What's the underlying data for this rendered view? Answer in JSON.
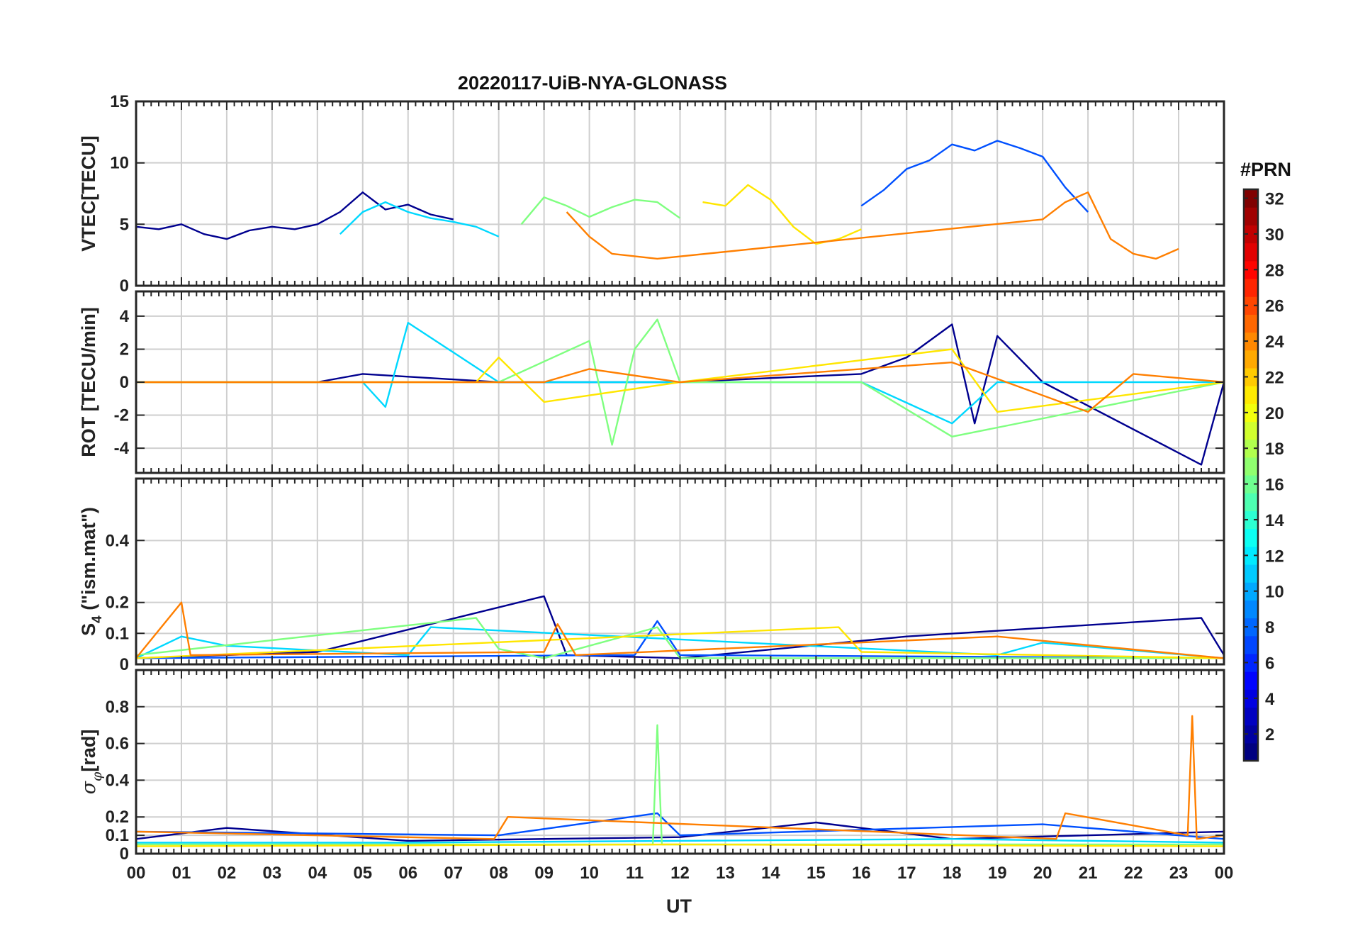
{
  "chart_data": {
    "type": "line",
    "title": "20220117-UiB-NYA-GLONASS",
    "xlabel": "UT",
    "xlim": [
      0,
      24
    ],
    "x_tick_labels": [
      "00",
      "01",
      "02",
      "03",
      "04",
      "05",
      "06",
      "07",
      "08",
      "09",
      "10",
      "11",
      "12",
      "13",
      "14",
      "15",
      "16",
      "17",
      "18",
      "19",
      "20",
      "21",
      "22",
      "23",
      "00"
    ],
    "colorbar": {
      "label": "#PRN",
      "range": [
        1,
        32
      ],
      "tick_labels": [
        "2",
        "4",
        "6",
        "8",
        "10",
        "12",
        "14",
        "16",
        "18",
        "20",
        "22",
        "24",
        "26",
        "28",
        "30",
        "32"
      ],
      "colormap": "jet"
    },
    "panels": [
      {
        "id": "vtec",
        "ylabel": "VTEC[TECU]",
        "ylim": [
          0,
          15
        ],
        "y_tick_labels": [
          "0",
          "5",
          "10",
          "15"
        ],
        "series": [
          {
            "color": "#00008f",
            "x": [
              0,
              0.5,
              1,
              1.5,
              2,
              2.5,
              3,
              3.5,
              4,
              4.5,
              5,
              5.5,
              6,
              6.5,
              7
            ],
            "y": [
              4.8,
              4.6,
              5.0,
              4.2,
              3.8,
              4.5,
              4.8,
              4.6,
              5.0,
              6.0,
              7.6,
              6.2,
              6.6,
              5.8,
              5.4
            ]
          },
          {
            "color": "#0050ff",
            "x": [
              16,
              16.5,
              17,
              17.5,
              18,
              18.5,
              19,
              19.5,
              20,
              20.5,
              21
            ],
            "y": [
              6.5,
              7.8,
              9.5,
              10.2,
              11.5,
              11.0,
              11.8,
              11.2,
              10.5,
              8.0,
              6.0
            ]
          },
          {
            "color": "#00d8ff",
            "x": [
              4.5,
              5,
              5.5,
              6,
              6.5,
              7,
              7.5,
              8
            ],
            "y": [
              4.2,
              6.0,
              6.8,
              6.0,
              5.5,
              5.2,
              4.8,
              4.0
            ]
          },
          {
            "color": "#7fff80",
            "x": [
              8.5,
              9,
              9.5,
              10,
              10.5,
              11,
              11.5,
              12
            ],
            "y": [
              5.0,
              7.2,
              6.5,
              5.6,
              6.4,
              7.0,
              6.8,
              5.5
            ]
          },
          {
            "color": "#ffe600",
            "x": [
              12.5,
              13,
              13.5,
              14,
              14.5,
              15,
              15.5,
              16
            ],
            "y": [
              6.8,
              6.5,
              8.2,
              7.0,
              4.8,
              3.4,
              3.8,
              4.6
            ]
          },
          {
            "color": "#ff7f00",
            "x": [
              9.5,
              10,
              10.5,
              11,
              11.5,
              20,
              20.5,
              21,
              21.5,
              22,
              22.5,
              23
            ],
            "y": [
              6.0,
              4.0,
              2.6,
              2.4,
              2.2,
              5.4,
              6.8,
              7.6,
              3.8,
              2.6,
              2.2,
              3.0
            ]
          }
        ]
      },
      {
        "id": "rot",
        "ylabel": "ROT [TECU/min]",
        "ylim": [
          -5.5,
          5.5
        ],
        "y_tick_labels": [
          "-4",
          "-2",
          "0",
          "2",
          "4"
        ],
        "y_ticks": [
          -4,
          -2,
          0,
          2,
          4
        ],
        "series": [
          {
            "color": "#00008f",
            "x": [
              0,
              4,
              5,
              8,
              12,
              16,
              17,
              18,
              18.5,
              19,
              20,
              23.5,
              24
            ],
            "y": [
              0,
              0,
              0.5,
              0,
              0,
              0.5,
              1.5,
              3.5,
              -2.5,
              2.8,
              0,
              -5,
              0
            ]
          },
          {
            "color": "#00d8ff",
            "x": [
              0,
              5,
              5.5,
              6,
              8,
              12,
              16,
              18,
              19,
              24
            ],
            "y": [
              0,
              0,
              -1.5,
              3.6,
              0,
              0,
              0,
              -2.5,
              0,
              0
            ]
          },
          {
            "color": "#7fff80",
            "x": [
              0,
              8,
              10,
              10.5,
              11,
              11.5,
              12,
              16,
              18,
              24
            ],
            "y": [
              0,
              0,
              2.5,
              -3.8,
              2.0,
              3.8,
              0,
              0,
              -3.3,
              0
            ]
          },
          {
            "color": "#ffe600",
            "x": [
              0,
              7.5,
              8,
              9,
              12,
              18,
              19,
              24
            ],
            "y": [
              0,
              0,
              1.5,
              -1.2,
              0,
              2.0,
              -1.8,
              0
            ]
          },
          {
            "color": "#ff7f00",
            "x": [
              0,
              9,
              10,
              12,
              18,
              21,
              22,
              24
            ],
            "y": [
              0,
              0,
              0.8,
              0,
              1.2,
              -1.8,
              0.5,
              0
            ]
          }
        ]
      },
      {
        "id": "s4",
        "ylabel": "S4 (\"ism.mat\")",
        "ylim": [
          0,
          0.6
        ],
        "y_tick_labels": [
          "0",
          "0.1",
          "0.2",
          "0.4"
        ],
        "y_ticks": [
          0,
          0.1,
          0.2,
          0.4
        ],
        "series": [
          {
            "color": "#00008f",
            "x": [
              0,
              4,
              9,
              9.5,
              12,
              17,
              23.5,
              24
            ],
            "y": [
              0.02,
              0.04,
              0.22,
              0.03,
              0.02,
              0.09,
              0.15,
              0.03
            ]
          },
          {
            "color": "#0050ff",
            "x": [
              0,
              11,
              11.5,
              12,
              24
            ],
            "y": [
              0.02,
              0.03,
              0.14,
              0.03,
              0.02
            ]
          },
          {
            "color": "#00d8ff",
            "x": [
              0,
              1,
              2,
              6,
              6.5,
              19,
              20,
              24
            ],
            "y": [
              0.02,
              0.09,
              0.06,
              0.03,
              0.12,
              0.03,
              0.07,
              0.02
            ]
          },
          {
            "color": "#7fff80",
            "x": [
              0,
              7.5,
              8,
              9,
              11.5,
              12,
              24
            ],
            "y": [
              0.03,
              0.15,
              0.05,
              0.02,
              0.12,
              0.02,
              0.02
            ]
          },
          {
            "color": "#ffe600",
            "x": [
              0,
              15.5,
              16,
              24
            ],
            "y": [
              0.02,
              0.12,
              0.04,
              0.02
            ]
          },
          {
            "color": "#ff7f00",
            "x": [
              0,
              1,
              1.2,
              9,
              9.3,
              9.7,
              19,
              24
            ],
            "y": [
              0.02,
              0.2,
              0.03,
              0.04,
              0.13,
              0.03,
              0.09,
              0.02
            ]
          }
        ]
      },
      {
        "id": "sigma_phi",
        "ylabel": "σ_φ[rad]",
        "ylim": [
          0,
          1.0
        ],
        "y_tick_labels": [
          "0",
          "0.1",
          "0.2",
          "0.4",
          "0.6",
          "0.8"
        ],
        "y_ticks": [
          0,
          0.1,
          0.2,
          0.4,
          0.6,
          0.8
        ],
        "series": [
          {
            "color": "#00008f",
            "x": [
              0,
              2,
              6,
              12,
              15,
              18,
              24
            ],
            "y": [
              0.08,
              0.14,
              0.07,
              0.09,
              0.17,
              0.08,
              0.12
            ]
          },
          {
            "color": "#0050ff",
            "x": [
              0,
              8,
              11.5,
              12,
              20,
              24
            ],
            "y": [
              0.12,
              0.1,
              0.22,
              0.1,
              0.16,
              0.08
            ]
          },
          {
            "color": "#00d8ff",
            "x": [
              0,
              6,
              12,
              18,
              24
            ],
            "y": [
              0.06,
              0.06,
              0.07,
              0.08,
              0.06
            ]
          },
          {
            "color": "#7fff80",
            "x": [
              0,
              11.4,
              11.5,
              11.6,
              24
            ],
            "y": [
              0.05,
              0.05,
              0.7,
              0.05,
              0.05
            ]
          },
          {
            "color": "#ffe600",
            "x": [
              0,
              12,
              24
            ],
            "y": [
              0.04,
              0.05,
              0.04
            ]
          },
          {
            "color": "#ff7f00",
            "x": [
              0,
              7.9,
              8.2,
              20.3,
              20.5,
              23.2,
              23.3,
              23.4,
              24
            ],
            "y": [
              0.12,
              0.08,
              0.2,
              0.08,
              0.22,
              0.1,
              0.75,
              0.08,
              0.1
            ]
          }
        ]
      }
    ]
  }
}
